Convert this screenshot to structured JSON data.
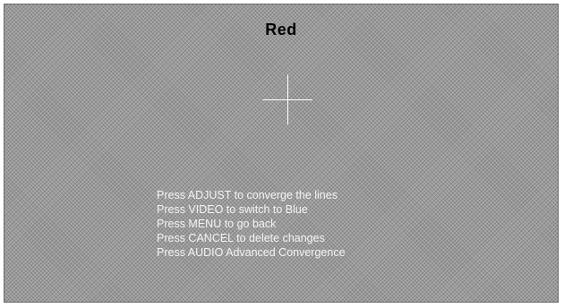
{
  "screen": {
    "title": "Red",
    "crosshair_icon": "crosshair-icon",
    "title_color": "#000000",
    "text_color": "#ffffff",
    "instructions": [
      "Press ADJUST to converge the lines",
      "Press VIDEO to switch to Blue",
      "Press MENU to go back",
      "Press CANCEL to delete changes",
      "Press AUDIO   Advanced Convergence"
    ]
  }
}
